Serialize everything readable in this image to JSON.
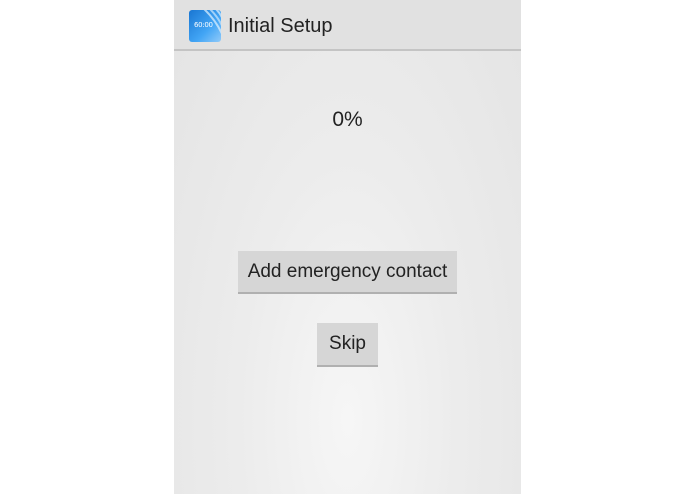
{
  "app": {
    "title": "Initial Setup",
    "icon": "app-logo-icon",
    "icon_text": "60:00",
    "accent": "#1e88e5"
  },
  "progress": {
    "label": "0%",
    "value": 0
  },
  "buttons": {
    "add_contact_label": "Add emergency contact",
    "skip_label": "Skip"
  }
}
